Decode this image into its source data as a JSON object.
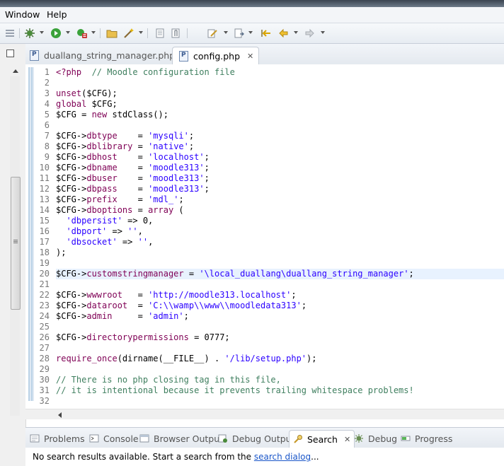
{
  "menubar": {
    "items": [
      "Window",
      "Help"
    ]
  },
  "editor_tabs": [
    {
      "label": "duallang_string_manager.php",
      "active": false
    },
    {
      "label": "config.php",
      "active": true,
      "close": "✕"
    }
  ],
  "editor": {
    "line_numbers": [
      "1",
      "2",
      "3",
      "4",
      "5",
      "6",
      "7",
      "8",
      "9",
      "10",
      "11",
      "12",
      "13",
      "14",
      "15",
      "16",
      "17",
      "18",
      "19",
      "20",
      "21",
      "22",
      "23",
      "24",
      "25",
      "26",
      "27",
      "28",
      "29",
      "30",
      "31",
      "32"
    ],
    "lines": [
      "<?php  // Moodle configuration file",
      "",
      "unset($CFG);",
      "global $CFG;",
      "$CFG = new stdClass();",
      "",
      "$CFG->dbtype    = 'mysqli';",
      "$CFG->dblibrary = 'native';",
      "$CFG->dbhost    = 'localhost';",
      "$CFG->dbname    = 'moodle313';",
      "$CFG->dbuser    = 'moodle313';",
      "$CFG->dbpass    = 'moodle313';",
      "$CFG->prefix    = 'mdl_';",
      "$CFG->dboptions = array (",
      "  'dbpersist' => 0,",
      "  'dbport' => '',",
      "  'dbsocket' => '',",
      ");",
      "",
      "$CFG->customstringmanager = '\\local_duallang\\duallang_string_manager';",
      "",
      "$CFG->wwwroot   = 'http://moodle313.localhost';",
      "$CFG->dataroot  = 'C:\\\\wamp\\\\www\\\\moodledata313';",
      "$CFG->admin     = 'admin';",
      "",
      "$CFG->directorypermissions = 0777;",
      "",
      "require_once(dirname(__FILE__) . '/lib/setup.php');",
      "",
      "// There is no php closing tag in this file,",
      "// it is intentional because it prevents trailing whitespace problems!",
      ""
    ],
    "highlighted_line": "20"
  },
  "view_tabs": [
    {
      "label": "Problems",
      "icon": "problems-icon"
    },
    {
      "label": "Console",
      "icon": "console-icon"
    },
    {
      "label": "Browser Output",
      "icon": "browser-output-icon"
    },
    {
      "label": "Debug Output",
      "icon": "debug-output-icon"
    },
    {
      "label": "Search",
      "icon": "search-icon",
      "active": true,
      "close": "✕"
    },
    {
      "label": "Debug",
      "icon": "debug-icon"
    },
    {
      "label": "Progress",
      "icon": "progress-icon"
    }
  ],
  "search_view": {
    "message": "No search results available. Start a search from the ",
    "link": "search dialog",
    "suffix": "..."
  },
  "colors": {
    "keyword": "#7f0055",
    "string": "#2a00ff",
    "comment": "#3f7f5f",
    "line_highlight": "#e8f2fe",
    "link": "#1a56c9"
  }
}
